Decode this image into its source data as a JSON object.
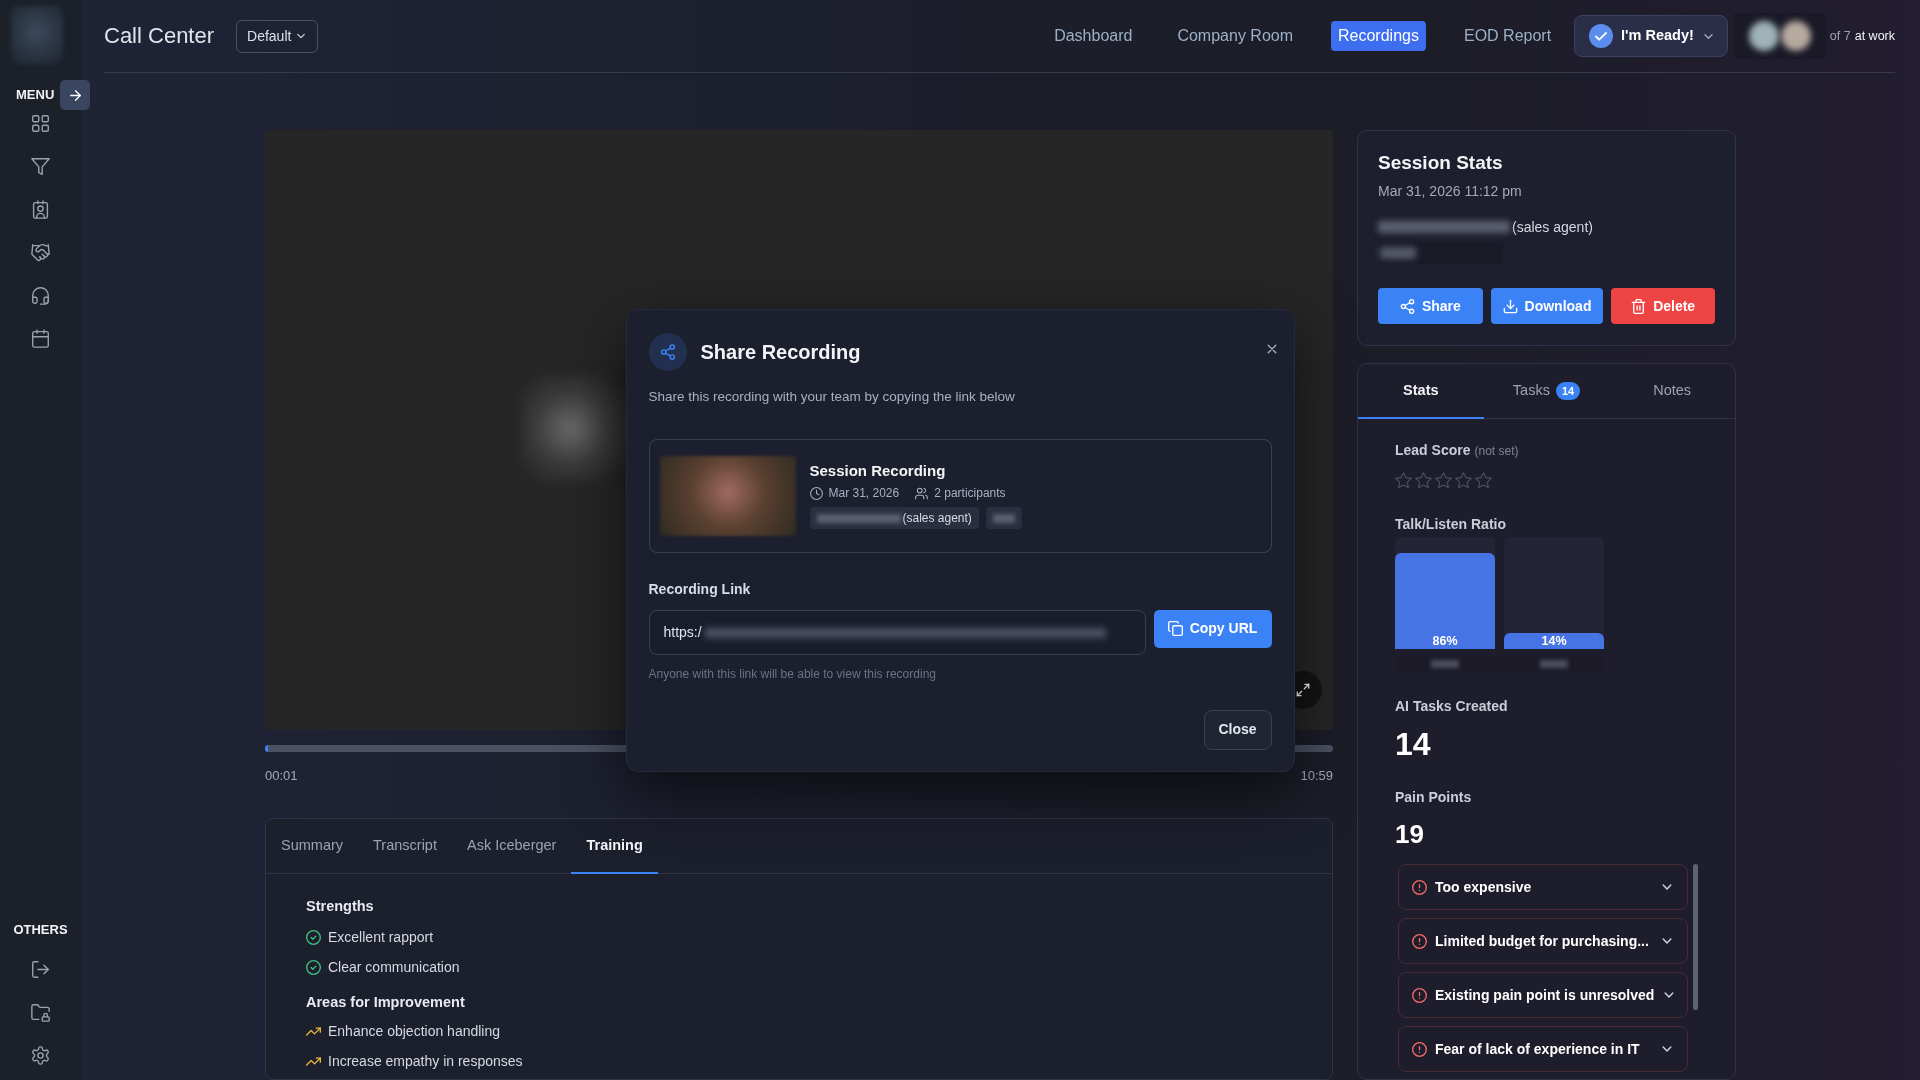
{
  "sidebar": {
    "menu_label": "MENU",
    "others_label": "OTHERS"
  },
  "header": {
    "title": "Call Center",
    "view_selector": "Default",
    "nav": [
      {
        "label": "Dashboard",
        "selected": false
      },
      {
        "label": "Company Room",
        "selected": false
      },
      {
        "label": "Recordings",
        "selected": true
      },
      {
        "label": "EOD Report",
        "selected": false
      }
    ],
    "status_button": "I'm Ready!",
    "presence": {
      "count": "of 7",
      "status": "at work"
    }
  },
  "player": {
    "level": 0.003,
    "current_time": "00:01",
    "duration": "10:59"
  },
  "details": {
    "tabs": [
      {
        "label": "Summary",
        "selected": false
      },
      {
        "label": "Transcript",
        "selected": false
      },
      {
        "label": "Ask Iceberger",
        "selected": false
      },
      {
        "label": "Training",
        "selected": true
      }
    ],
    "strengths_title": "Strengths",
    "strengths": [
      "Excellent rapport",
      "Clear communication"
    ],
    "improvements_title": "Areas for Improvement",
    "improvements": [
      "Enhance objection handling",
      "Increase empathy in responses"
    ]
  },
  "session_stats": {
    "title": "Session Stats",
    "date": "Mar 31, 2026 11:12 pm",
    "agent_role": "(sales agent)",
    "buttons": [
      {
        "label": "Share",
        "kind": "share"
      },
      {
        "label": "Download",
        "kind": "download"
      },
      {
        "label": "Delete",
        "kind": "delete"
      }
    ]
  },
  "stats_panel": {
    "tabs": [
      {
        "label": "Stats",
        "selected": true
      },
      {
        "label": "Tasks",
        "badge": "14",
        "selected": false
      },
      {
        "label": "Notes",
        "selected": false
      }
    ],
    "lead_score": {
      "label": "Lead Score",
      "note": "(not set)",
      "stars": 0
    },
    "talk_listen": {
      "label": "Talk/Listen Ratio",
      "bars": [
        {
          "share": "86%",
          "level": 0.86
        },
        {
          "share": "14%",
          "level": 0.14
        }
      ]
    },
    "ai_tasks": {
      "label": "AI Tasks Created",
      "value": "14"
    },
    "pain_points": {
      "label": "Pain Points",
      "value": "19",
      "items": [
        {
          "text": "Too expensive",
          "expanded": false
        },
        {
          "text": "Limited budget for purchasing...",
          "expanded": false
        },
        {
          "text": "Existing pain point is unresolved",
          "expanded": false
        },
        {
          "text": "Fear of lack of experience in IT",
          "expanded": false
        }
      ]
    }
  },
  "share_modal": {
    "title": "Share Recording",
    "subtitle": "Share this recording with your team by copying the link below",
    "recording": {
      "title": "Session Recording",
      "date": "Mar 31, 2026",
      "participants": "2 participants",
      "agent_role": "(sales agent)"
    },
    "link_label": "Recording Link",
    "link_value": "https:/",
    "copy_button": "Copy URL",
    "hint": "Anyone with this link will be able to view this recording",
    "close_button": "Close"
  }
}
